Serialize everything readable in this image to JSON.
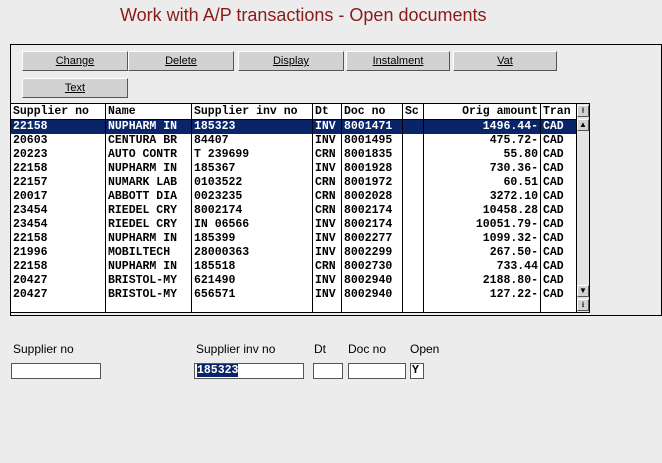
{
  "window": {
    "title": "Work with A/P transactions - Open documents"
  },
  "toolbar": {
    "change": "Change",
    "delete": "Delete",
    "display": "Display",
    "instalment": "Instalment",
    "vat": "Vat",
    "text": "Text"
  },
  "table": {
    "headers": [
      "Supplier no",
      "Name",
      "Supplier inv no",
      "Dt",
      "Doc no",
      "Sc",
      "Orig amount",
      "Tran"
    ],
    "rows": [
      [
        "22158",
        "NUPHARM IN",
        "185323",
        "INV",
        "8001471",
        "",
        "1496.44-",
        "CAD"
      ],
      [
        "20603",
        "CENTURA BR",
        "84407",
        "INV",
        "8001495",
        "",
        "475.72-",
        "CAD"
      ],
      [
        "20223",
        "AUTO CONTR",
        "T 239699",
        "CRN",
        "8001835",
        "",
        "55.80",
        "CAD"
      ],
      [
        "22158",
        "NUPHARM IN",
        "185367",
        "INV",
        "8001928",
        "",
        "730.36-",
        "CAD"
      ],
      [
        "22157",
        "NUMARK LAB",
        "0103522",
        "CRN",
        "8001972",
        "",
        "60.51",
        "CAD"
      ],
      [
        "20017",
        "ABBOTT DIA",
        "0023235",
        "CRN",
        "8002028",
        "",
        "3272.10",
        "CAD"
      ],
      [
        "23454",
        "RIEDEL CRY",
        "8002174",
        "CRN",
        "8002174",
        "",
        "10458.28",
        "CAD"
      ],
      [
        "23454",
        "RIEDEL CRY",
        "IN 06566",
        "INV",
        "8002174",
        "",
        "10051.79-",
        "CAD"
      ],
      [
        "22158",
        "NUPHARM IN",
        "185399",
        "INV",
        "8002277",
        "",
        "1099.32-",
        "CAD"
      ],
      [
        "21996",
        "MOBILTECH",
        "28000363",
        "INV",
        "8002299",
        "",
        "267.50-",
        "CAD"
      ],
      [
        "22158",
        "NUPHARM IN",
        "185518",
        "CRN",
        "8002730",
        "",
        "733.44",
        "CAD"
      ],
      [
        "20427",
        "BRISTOL-MY",
        "621490",
        "INV",
        "8002940",
        "",
        "2188.80-",
        "CAD"
      ],
      [
        "20427",
        "BRISTOL-MY",
        "656571",
        "INV",
        "8002940",
        "",
        "127.22-",
        "CAD"
      ]
    ]
  },
  "filters": {
    "supplier_no_label": "Supplier no",
    "supplier_no_value": "",
    "supplier_inv_label": "Supplier inv no",
    "supplier_inv_value": "185323",
    "dt_label": "Dt",
    "dt_value": "",
    "doc_no_label": "Doc no",
    "doc_no_value": "",
    "open_label": "Open",
    "open_value": "Y"
  },
  "icons": {
    "scroll_up": "scroll-up-icon",
    "scroll_down": "scroll-down-icon"
  }
}
